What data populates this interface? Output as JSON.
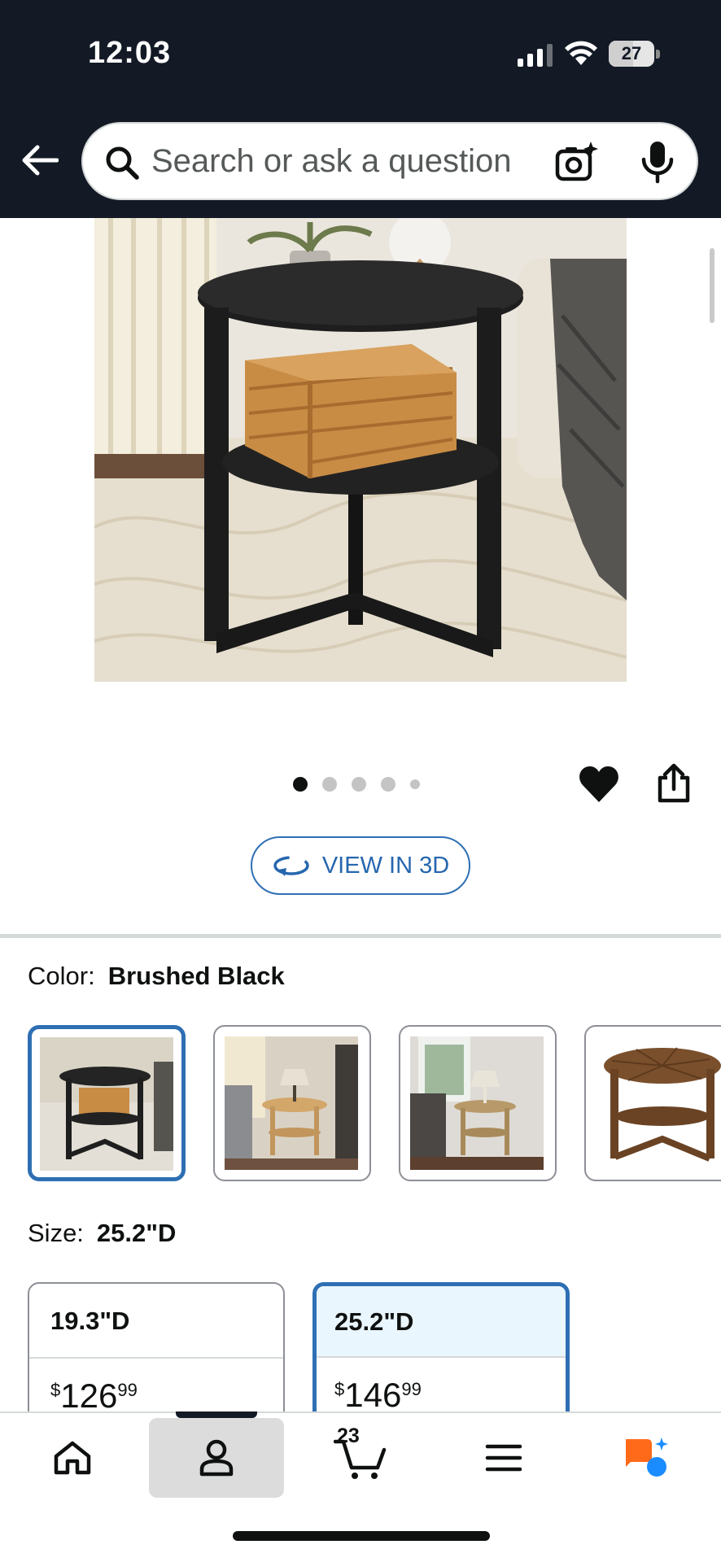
{
  "status_bar": {
    "time": "12:03",
    "battery_level": "27"
  },
  "header": {
    "search_placeholder": "Search or ask a question"
  },
  "gallery": {
    "image_count": 5,
    "active_index": 0,
    "view_3d_label": "VIEW IN 3D"
  },
  "color": {
    "label": "Color:",
    "selected": "Brushed Black",
    "swatch_count": 4,
    "selected_index": 0
  },
  "size": {
    "label": "Size:",
    "selected": "25.2\"D",
    "options": [
      {
        "label": "19.3\"D",
        "price_dollars": "$",
        "price_whole": "126",
        "price_fraction": "99"
      },
      {
        "label": "25.2\"D",
        "price_dollars": "$",
        "price_whole": "146",
        "price_fraction": "99"
      }
    ]
  },
  "bottom_nav": {
    "cart_count": "23",
    "active_tab": "account"
  },
  "colors": {
    "header_bg": "#131a26",
    "accent_blue": "#2e6fb3",
    "selected_bg": "#eaf6fd",
    "rufus_orange": "#ff6a1a",
    "rufus_blue": "#1a8cff"
  }
}
